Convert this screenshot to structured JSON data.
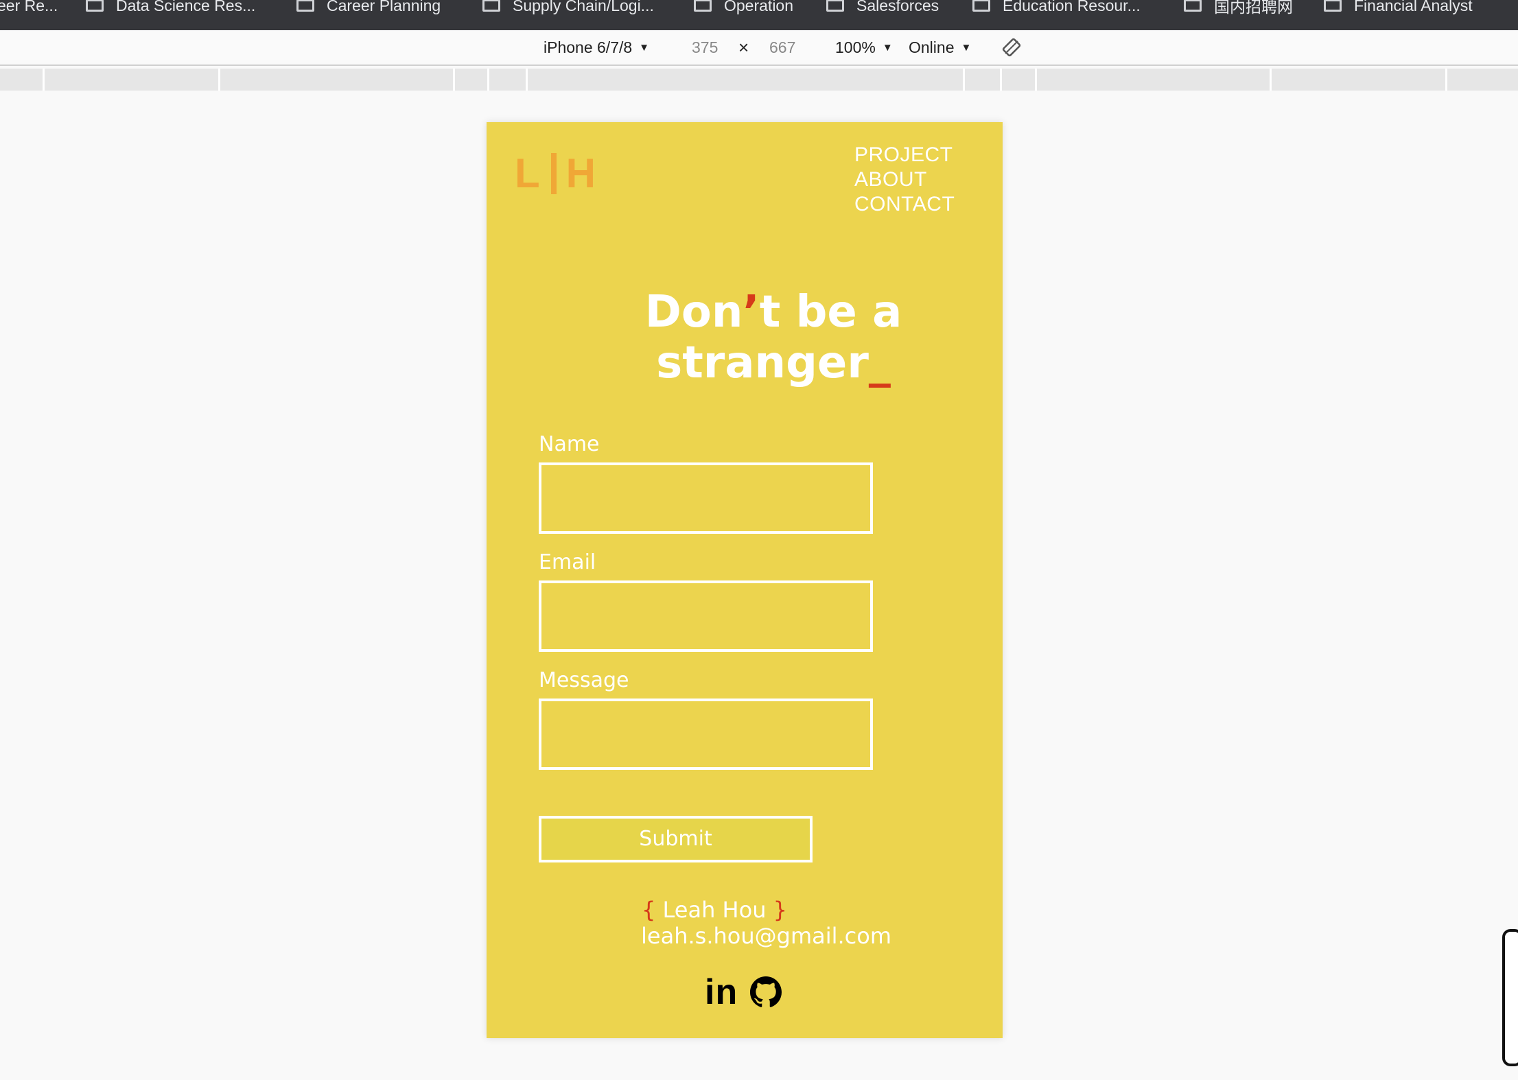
{
  "bookmarks": [
    {
      "label": "eer Re..."
    },
    {
      "label": "Data Science Res..."
    },
    {
      "label": "Career Planning"
    },
    {
      "label": "Supply Chain/Logi..."
    },
    {
      "label": "Operation"
    },
    {
      "label": "Salesforces"
    },
    {
      "label": "Education Resour..."
    },
    {
      "label": "国内招聘网"
    },
    {
      "label": "Financial Analyst"
    }
  ],
  "device_toolbar": {
    "device": "iPhone 6/7/8",
    "width": "375",
    "times": "×",
    "height": "667",
    "zoom": "100%",
    "network": "Online"
  },
  "site": {
    "logo_left": "L",
    "logo_right": "H",
    "nav": [
      "PROJECT",
      "ABOUT",
      "CONTACT"
    ],
    "heading": {
      "line1_a": "Don",
      "apostrophe": "’",
      "line1_b": "t be a",
      "line2": "stranger",
      "cursor": "_"
    },
    "form": {
      "name_label": "Name",
      "email_label": "Email",
      "message_label": "Message",
      "submit_label": "Submit"
    },
    "footer": {
      "open_brace": "{",
      "name": " Leah Hou ",
      "close_brace": "}",
      "email": "leah.s.hou@gmail.com"
    },
    "social_linkedin": "in"
  }
}
